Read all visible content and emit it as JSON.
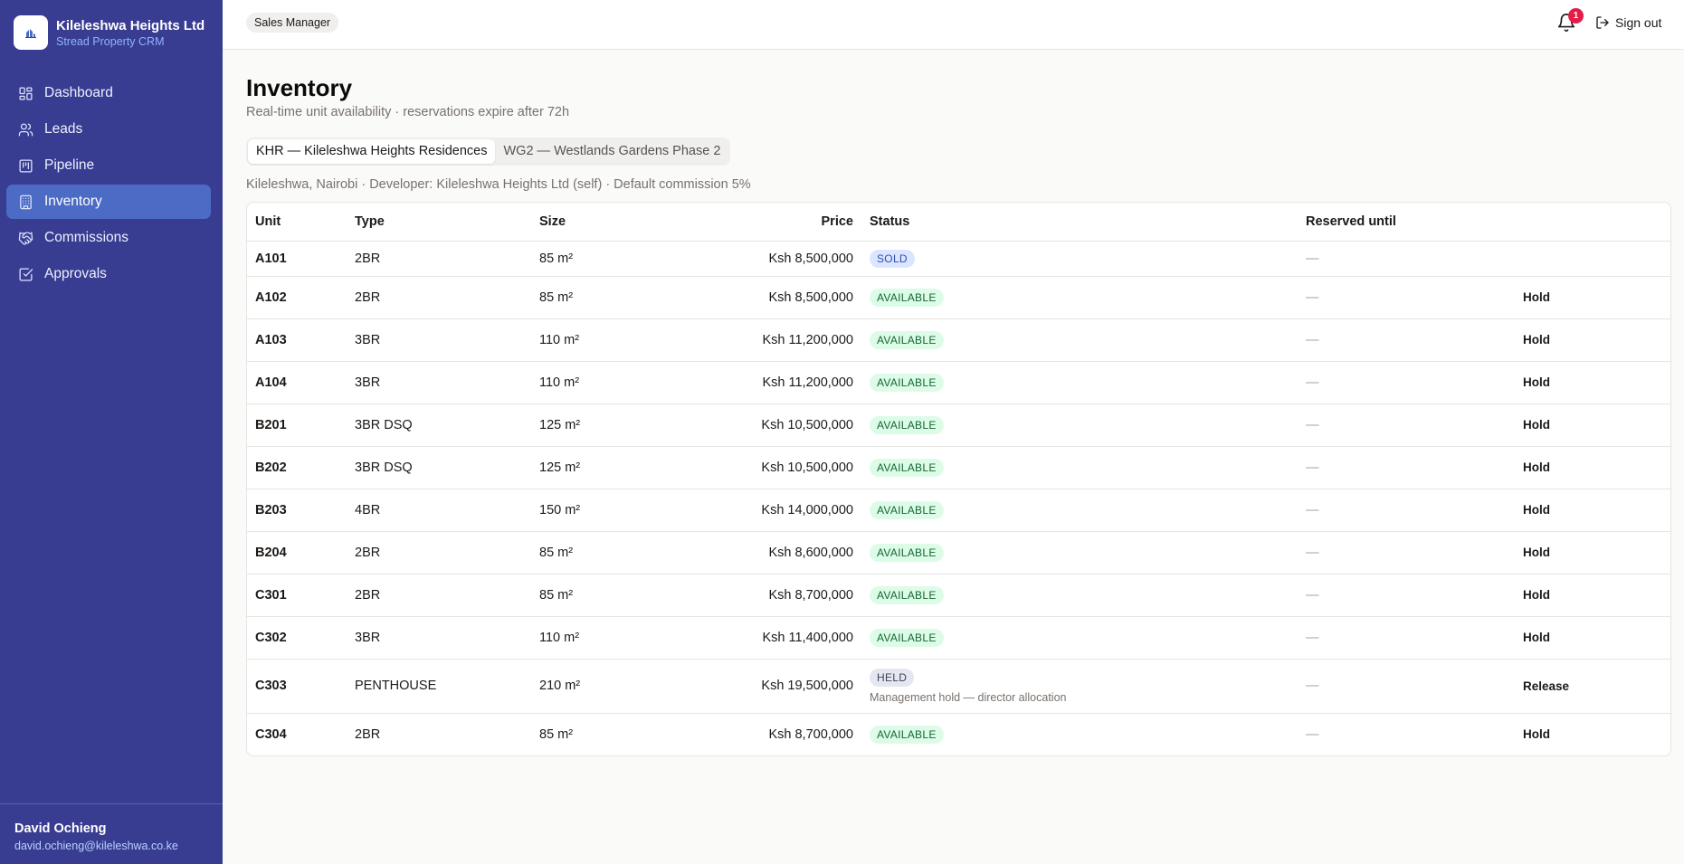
{
  "company": {
    "name": "Kileleshwa Heights Ltd",
    "subtitle": "Stread Property CRM",
    "logo_icon": "building-logo-icon"
  },
  "nav": {
    "items": [
      {
        "label": "Dashboard",
        "icon": "dashboard-icon",
        "active": false
      },
      {
        "label": "Leads",
        "icon": "users-icon",
        "active": false
      },
      {
        "label": "Pipeline",
        "icon": "kanban-icon",
        "active": false
      },
      {
        "label": "Inventory",
        "icon": "building-icon",
        "active": true
      },
      {
        "label": "Commissions",
        "icon": "handshake-icon",
        "active": false
      },
      {
        "label": "Approvals",
        "icon": "check-square-icon",
        "active": false
      }
    ]
  },
  "user": {
    "name": "David Ochieng",
    "email": "david.ochieng@kileleshwa.co.ke"
  },
  "header": {
    "role": "Sales Manager",
    "notification_count": "1",
    "signout_label": "Sign out"
  },
  "page": {
    "title": "Inventory",
    "subtitle": "Real-time unit availability · reservations expire after 72h",
    "tabs": [
      {
        "label": "KHR — Kileleshwa Heights Residences",
        "active": true
      },
      {
        "label": "WG2 — Westlands Gardens Phase 2",
        "active": false
      }
    ],
    "project_meta": "Kileleshwa, Nairobi · Developer: Kileleshwa Heights Ltd (self) · Default commission 5%"
  },
  "table": {
    "headers": {
      "unit": "Unit",
      "type": "Type",
      "size": "Size",
      "price": "Price",
      "status": "Status",
      "reserved": "Reserved until"
    },
    "rows": [
      {
        "unit": "A101",
        "type": "2BR",
        "size": "85 m²",
        "price": "Ksh 8,500,000",
        "status": "SOLD",
        "status_kind": "sold",
        "note": "",
        "reserved": "—",
        "action": ""
      },
      {
        "unit": "A102",
        "type": "2BR",
        "size": "85 m²",
        "price": "Ksh 8,500,000",
        "status": "AVAILABLE",
        "status_kind": "available",
        "note": "",
        "reserved": "—",
        "action": "Hold"
      },
      {
        "unit": "A103",
        "type": "3BR",
        "size": "110 m²",
        "price": "Ksh 11,200,000",
        "status": "AVAILABLE",
        "status_kind": "available",
        "note": "",
        "reserved": "—",
        "action": "Hold"
      },
      {
        "unit": "A104",
        "type": "3BR",
        "size": "110 m²",
        "price": "Ksh 11,200,000",
        "status": "AVAILABLE",
        "status_kind": "available",
        "note": "",
        "reserved": "—",
        "action": "Hold"
      },
      {
        "unit": "B201",
        "type": "3BR DSQ",
        "size": "125 m²",
        "price": "Ksh 10,500,000",
        "status": "AVAILABLE",
        "status_kind": "available",
        "note": "",
        "reserved": "—",
        "action": "Hold"
      },
      {
        "unit": "B202",
        "type": "3BR DSQ",
        "size": "125 m²",
        "price": "Ksh 10,500,000",
        "status": "AVAILABLE",
        "status_kind": "available",
        "note": "",
        "reserved": "—",
        "action": "Hold"
      },
      {
        "unit": "B203",
        "type": "4BR",
        "size": "150 m²",
        "price": "Ksh 14,000,000",
        "status": "AVAILABLE",
        "status_kind": "available",
        "note": "",
        "reserved": "—",
        "action": "Hold"
      },
      {
        "unit": "B204",
        "type": "2BR",
        "size": "85 m²",
        "price": "Ksh 8,600,000",
        "status": "AVAILABLE",
        "status_kind": "available",
        "note": "",
        "reserved": "—",
        "action": "Hold"
      },
      {
        "unit": "C301",
        "type": "2BR",
        "size": "85 m²",
        "price": "Ksh 8,700,000",
        "status": "AVAILABLE",
        "status_kind": "available",
        "note": "",
        "reserved": "—",
        "action": "Hold"
      },
      {
        "unit": "C302",
        "type": "3BR",
        "size": "110 m²",
        "price": "Ksh 11,400,000",
        "status": "AVAILABLE",
        "status_kind": "available",
        "note": "",
        "reserved": "—",
        "action": "Hold"
      },
      {
        "unit": "C303",
        "type": "PENTHOUSE",
        "size": "210 m²",
        "price": "Ksh 19,500,000",
        "status": "HELD",
        "status_kind": "held",
        "note": "Management hold — director allocation",
        "reserved": "—",
        "action": "Release"
      },
      {
        "unit": "C304",
        "type": "2BR",
        "size": "85 m²",
        "price": "Ksh 8,700,000",
        "status": "AVAILABLE",
        "status_kind": "available",
        "note": "",
        "reserved": "—",
        "action": "Hold"
      }
    ]
  },
  "colors": {
    "sidebar_bg": "#383d91",
    "nav_active_bg": "#4b6bc4",
    "accent_subtitle": "#8fb4ff",
    "notification_badge": "#e11d48",
    "available_bg": "#dcfce7",
    "available_text": "#166534",
    "sold_bg": "#dbe5ff",
    "held_bg": "#e5e7f0"
  }
}
